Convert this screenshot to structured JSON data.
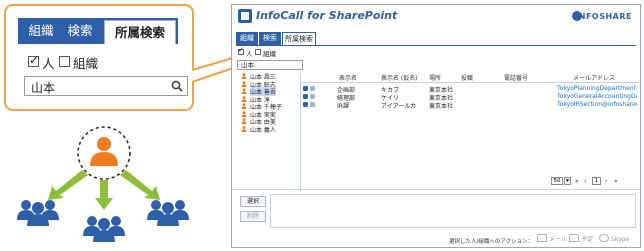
{
  "callout": {
    "tabs": [
      "組織",
      "検索",
      "所属検索"
    ],
    "person_label": "人",
    "org_label": "組織",
    "search_value": "山本"
  },
  "diagram": {
    "colors": {
      "center": "#f07a1e",
      "people": "#2f5fa8",
      "arrows": "#8fbf3a"
    }
  },
  "window": {
    "title": "InfoCall for SharePoint",
    "brand": "INFOSHARE",
    "tabs": [
      "組織",
      "検索",
      "所属検索"
    ],
    "person_label": "人",
    "org_label": "組織",
    "search_value": "山本",
    "people": [
      "山本 昌三",
      "山本 聡志",
      "山本 善吾",
      "山本 淳",
      "山本 千穂子",
      "山本 実実",
      "山本 由美",
      "山本 義人"
    ],
    "selected_person_index": 2,
    "columns": [
      "表示名",
      "表示名 (仮名)",
      "場所",
      "役職",
      "電話番号",
      "メールアドレス"
    ],
    "rows": [
      {
        "name": "企画部",
        "kana": "キカブ",
        "place": "東京本社",
        "title": "",
        "phone": "",
        "mail": "TokyoPlanningDepartment..."
      },
      {
        "name": "経理部",
        "kana": "ケイリ",
        "place": "東京本社",
        "title": "",
        "phone": "",
        "mail": "TokyoGeneralAccountingDe..."
      },
      {
        "name": "IR課",
        "kana": "アイアールカ",
        "place": "東京本社",
        "title": "",
        "phone": "",
        "mail": "TokyoIRSection@infoshared..."
      }
    ],
    "pager": {
      "page_size": "50",
      "first": "«",
      "prev": "‹",
      "page": "1",
      "next": "›",
      "last": "»"
    },
    "buttons": {
      "select": "選択",
      "delete": "削除"
    },
    "action_label": "選択した人/組織へのアクション：",
    "actions": [
      "メール",
      "予定",
      "Skype"
    ]
  }
}
